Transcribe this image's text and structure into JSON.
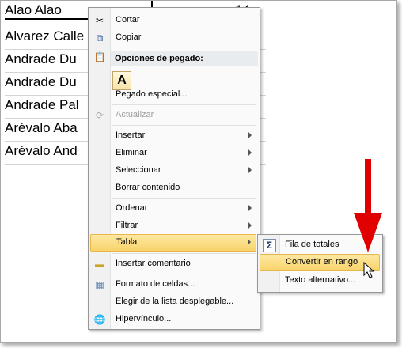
{
  "sheet": {
    "top_name": "Alao Alao",
    "top_value": "14",
    "rows": [
      "Alvarez Calle",
      "Andrade Du",
      "Andrade Du",
      "Andrade Pal",
      "Arévalo Aba",
      "Arévalo And"
    ]
  },
  "menu": {
    "cut": "Cortar",
    "copy": "Copiar",
    "paste_header": "Opciones de pegado:",
    "paste_option": "A",
    "paste_special": "Pegado especial...",
    "refresh": "Actualizar",
    "insert": "Insertar",
    "delete": "Eliminar",
    "select": "Seleccionar",
    "clear": "Borrar contenido",
    "sort": "Ordenar",
    "filter": "Filtrar",
    "table": "Tabla",
    "insert_comment": "Insertar comentario",
    "format_cells": "Formato de celdas...",
    "pick_list": "Elegir de la lista desplegable...",
    "hyperlink": "Hipervínculo..."
  },
  "submenu": {
    "totals_row": "Fila de totales",
    "convert_range": "Convertir en rango",
    "alt_text": "Texto alternativo..."
  },
  "colors": {
    "highlight": "#f8d46a",
    "arrow": "#e00000"
  }
}
